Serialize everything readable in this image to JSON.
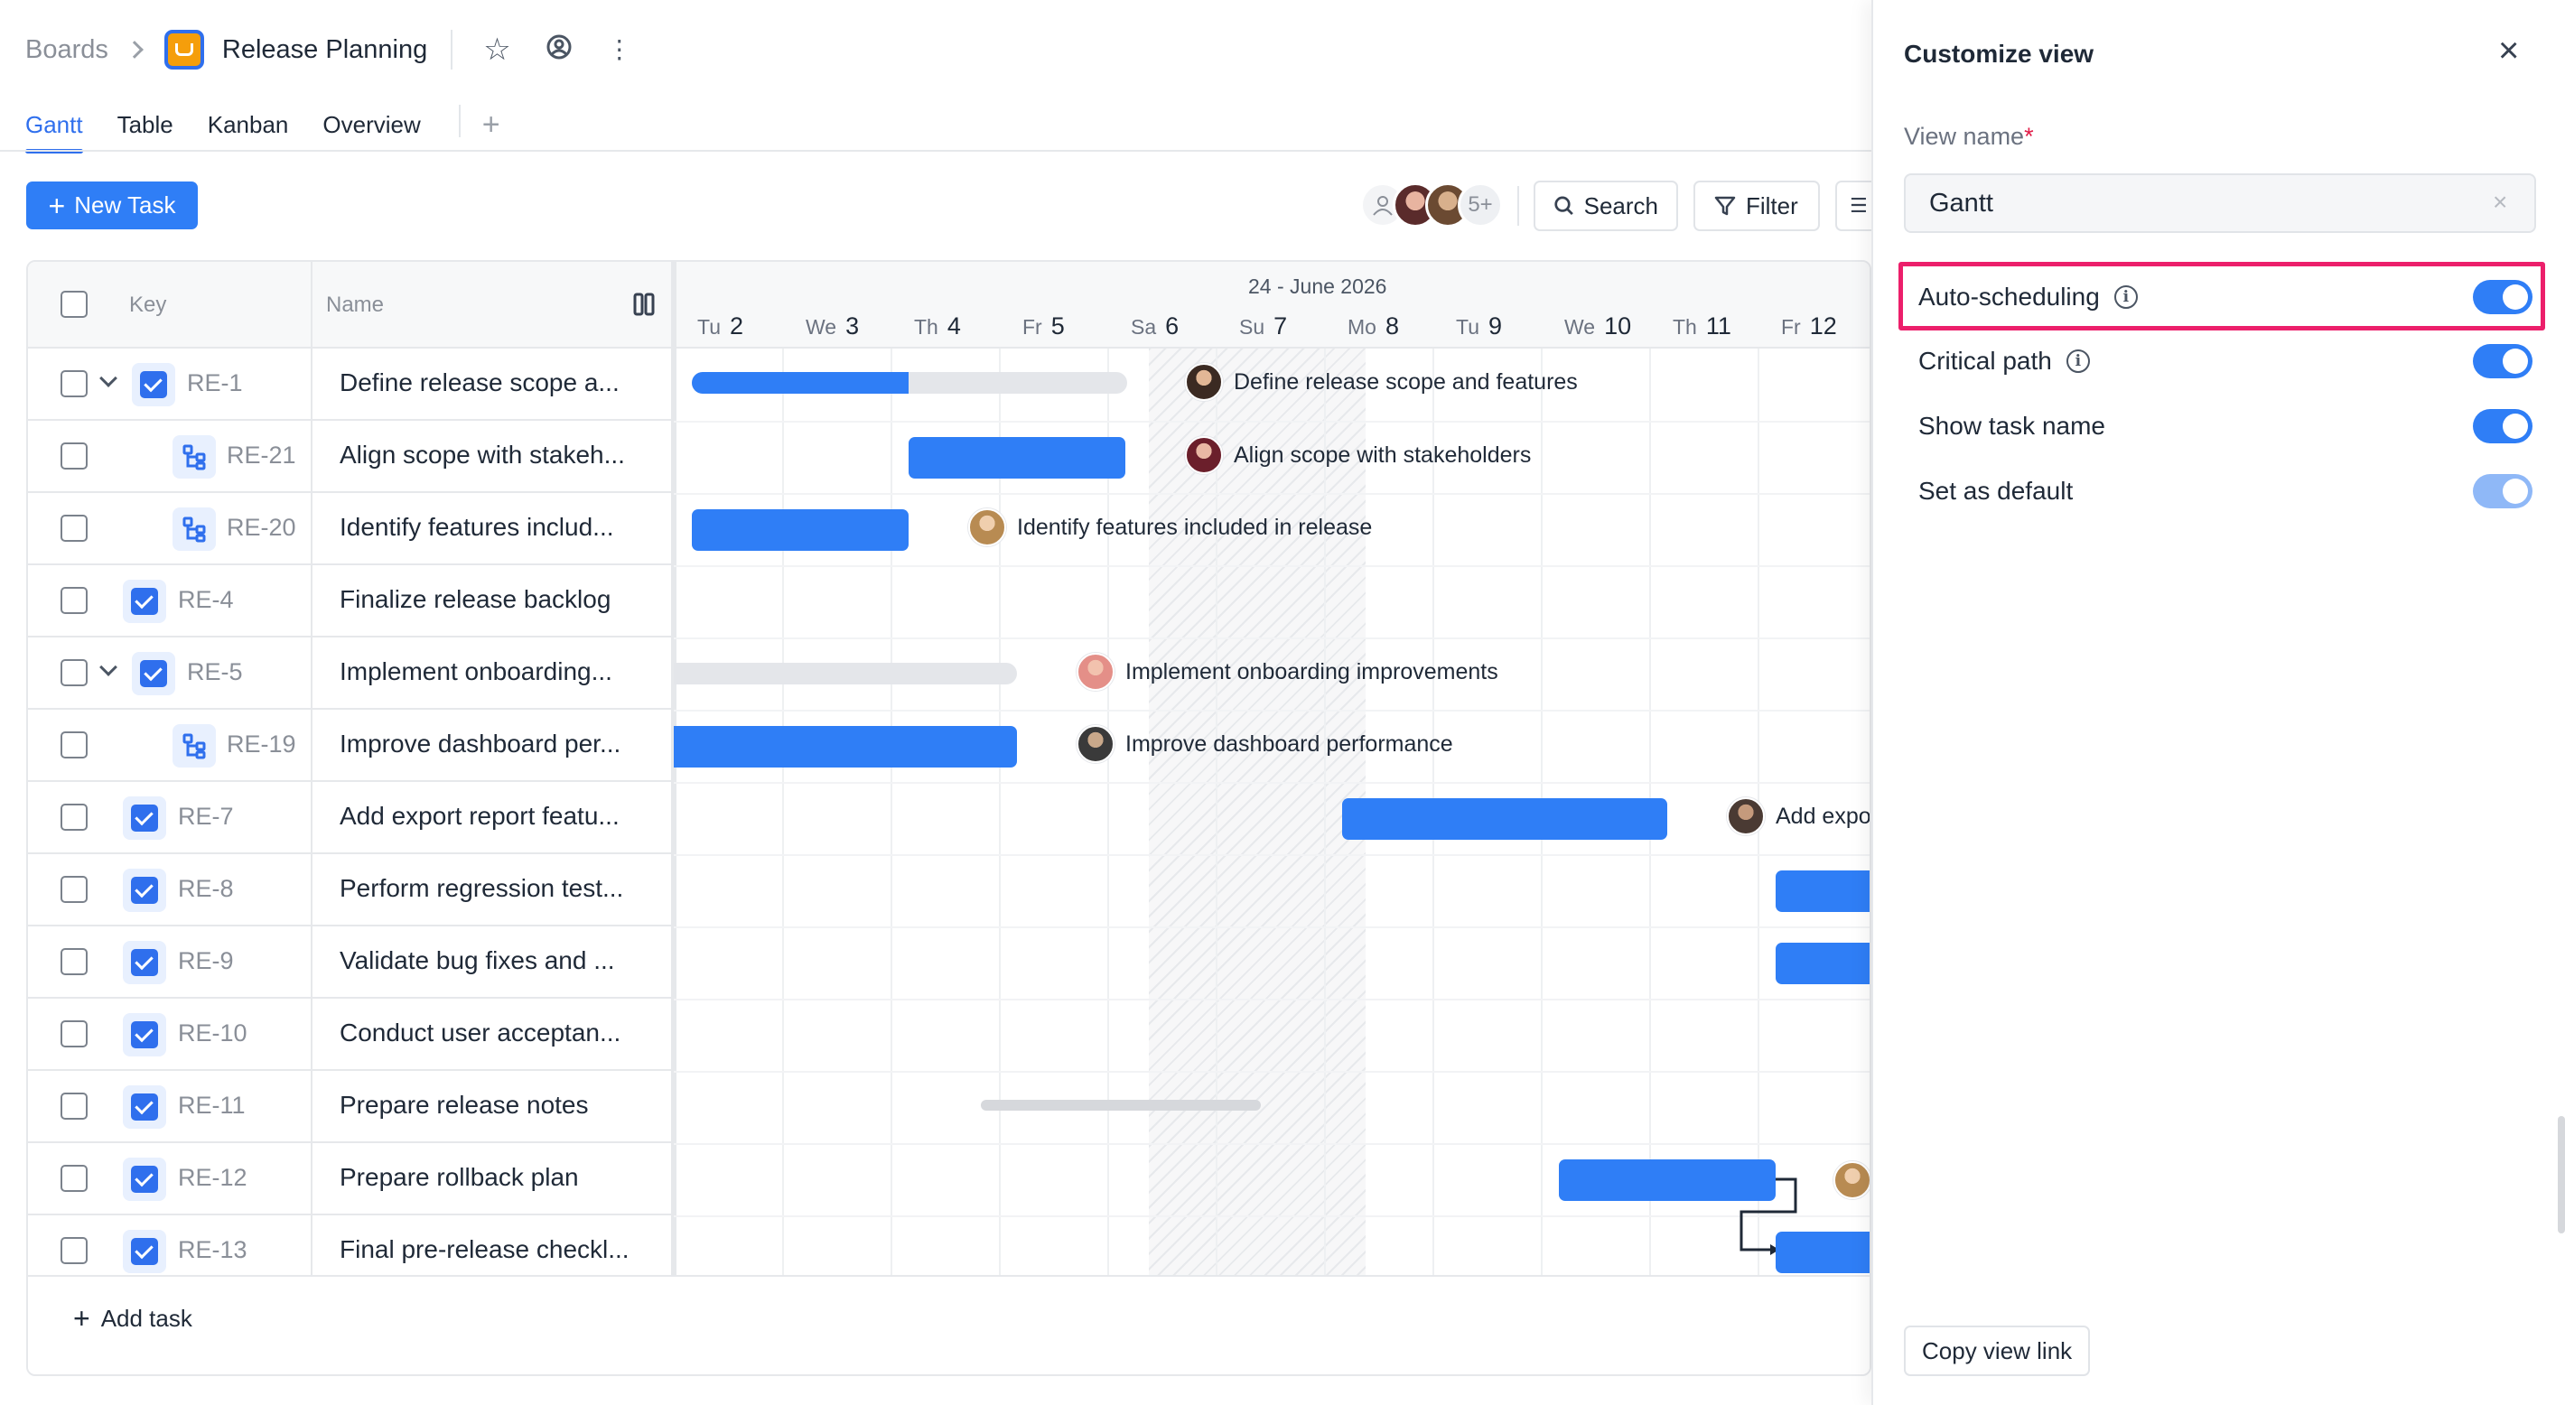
{
  "header": {
    "breadcrumb_root": "Boards",
    "board_title": "Release Planning",
    "tabs": [
      "Gantt",
      "Table",
      "Kanban",
      "Overview"
    ],
    "active_tab": "Gantt"
  },
  "toolbar": {
    "new_task_label": "New Task",
    "avatars_more": "5+",
    "search_label": "Search",
    "filter_label": "Filter"
  },
  "grid": {
    "col_key": "Key",
    "col_name": "Name",
    "rows": [
      {
        "key": "RE-1",
        "name": "Define release scope a...",
        "type": "task",
        "expand": true
      },
      {
        "key": "RE-21",
        "name": "Align scope with stakeh...",
        "type": "subtask"
      },
      {
        "key": "RE-20",
        "name": "Identify features includ...",
        "type": "subtask"
      },
      {
        "key": "RE-4",
        "name": "Finalize release backlog",
        "type": "task"
      },
      {
        "key": "RE-5",
        "name": "Implement onboarding...",
        "type": "task",
        "expand": true
      },
      {
        "key": "RE-19",
        "name": "Improve dashboard per...",
        "type": "subtask"
      },
      {
        "key": "RE-7",
        "name": "Add export report featu...",
        "type": "task"
      },
      {
        "key": "RE-8",
        "name": "Perform regression test...",
        "type": "task"
      },
      {
        "key": "RE-9",
        "name": "Validate bug fixes and ...",
        "type": "task"
      },
      {
        "key": "RE-10",
        "name": "Conduct user acceptan...",
        "type": "task"
      },
      {
        "key": "RE-11",
        "name": "Prepare release notes",
        "type": "task"
      },
      {
        "key": "RE-12",
        "name": "Prepare rollback plan",
        "type": "task"
      },
      {
        "key": "RE-13",
        "name": "Final pre-release checkl...",
        "type": "task"
      }
    ],
    "add_task_label": "Add task"
  },
  "timeline": {
    "month_label": "24 - June 2026",
    "days": [
      {
        "dow": "Tu",
        "num": "2"
      },
      {
        "dow": "We",
        "num": "3"
      },
      {
        "dow": "Th",
        "num": "4"
      },
      {
        "dow": "Fr",
        "num": "5"
      },
      {
        "dow": "Sa",
        "num": "6"
      },
      {
        "dow": "Su",
        "num": "7"
      },
      {
        "dow": "Mo",
        "num": "8"
      },
      {
        "dow": "Tu",
        "num": "9"
      },
      {
        "dow": "We",
        "num": "10"
      },
      {
        "dow": "Th",
        "num": "11"
      },
      {
        "dow": "Fr",
        "num": "12"
      }
    ],
    "bar_labels": [
      "Define release scope and features",
      "Align scope with stakeholders",
      "Identify features included in release",
      "Implement onboarding improvements",
      "Improve dashboard performance",
      "Add expor"
    ]
  },
  "panel": {
    "title": "Customize view",
    "view_name_label": "View name",
    "required_mark": "*",
    "view_name_value": "Gantt",
    "options": [
      {
        "label": "Auto-scheduling",
        "info": true,
        "enabled": true
      },
      {
        "label": "Critical path",
        "info": true,
        "enabled": true
      },
      {
        "label": "Show task name",
        "info": false,
        "enabled": true
      },
      {
        "label": "Set as default",
        "info": false,
        "enabled": true
      }
    ],
    "copy_link_label": "Copy view link"
  },
  "colors": {
    "accent": "#2f7ef6",
    "highlight": "#ec1f6b",
    "bar_grey": "#e4e6ea"
  },
  "icons": [
    "chevron-right-icon",
    "board-app-icon",
    "star-icon",
    "watch-icon",
    "more-vertical-icon",
    "plus-icon",
    "search-icon",
    "filter-icon",
    "columns-icon",
    "subtask-icon",
    "checkbox-task-icon",
    "close-icon",
    "info-icon"
  ]
}
